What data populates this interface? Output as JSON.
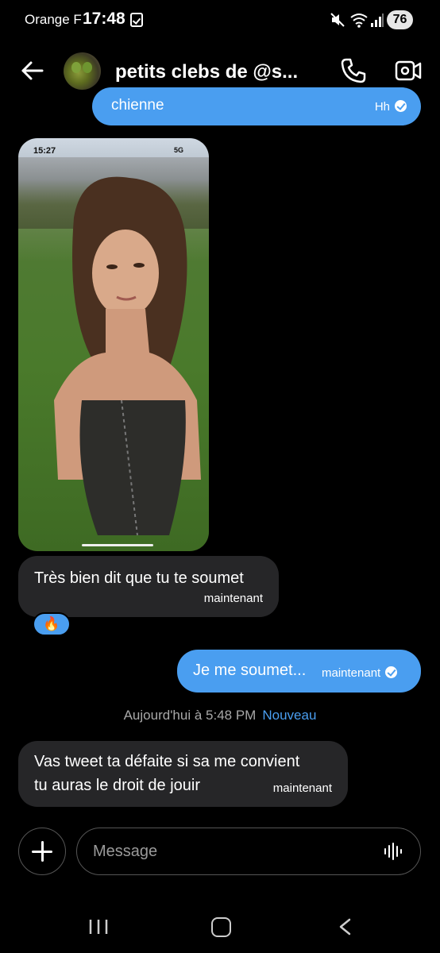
{
  "status_bar": {
    "carrier": "Orange F",
    "time": "17:48",
    "battery": "76",
    "icons": [
      "notification-check-icon",
      "mute-icon",
      "wifi-icon",
      "signal-icon"
    ]
  },
  "header": {
    "title": "petits clebs de @s...",
    "icons": [
      "back-arrow-icon",
      "phone-icon",
      "video-call-icon"
    ]
  },
  "messages": {
    "partial_sent": {
      "text": "chienne",
      "time": "Hh"
    },
    "photo": {
      "status_time": "15:27",
      "network": "5G"
    },
    "received_1": {
      "text": "Très bien dit que tu te soumet",
      "time": "maintenant",
      "reaction": "🔥"
    },
    "sent_2": {
      "text": "Je me soumet...",
      "time": "maintenant"
    },
    "date_separator": {
      "text": "Aujourd'hui à 5:48 PM",
      "new_label": "Nouveau"
    },
    "received_3": {
      "line1": "Vas tweet ta défaite si sa me convient",
      "line2": "tu auras le droit de jouir",
      "time": "maintenant"
    }
  },
  "composer": {
    "placeholder": "Message",
    "icons": [
      "plus-icon",
      "voice-icon"
    ]
  },
  "colors": {
    "background": "#000000",
    "sent_bubble": "#4a9ef0",
    "received_bubble": "#262628",
    "accent": "#4a9ef0"
  }
}
